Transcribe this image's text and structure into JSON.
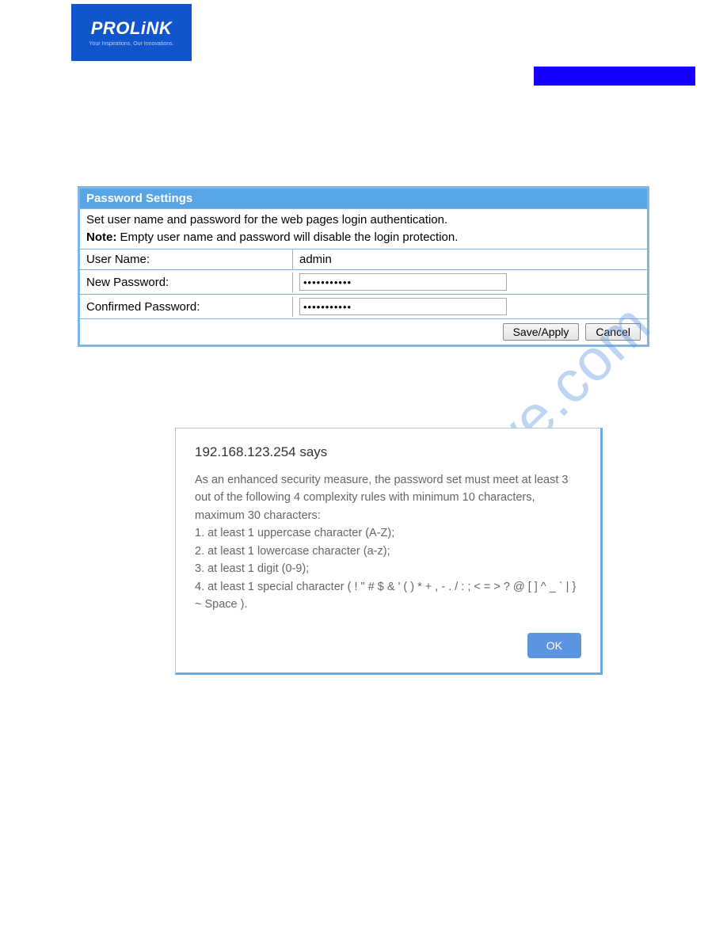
{
  "logo": {
    "brand": "PROLiNK",
    "tagline": "Your Inspirations, Our Innovations."
  },
  "panel": {
    "title": "Password Settings",
    "desc": "Set user name and password for the web pages login authentication.",
    "note_label": "Note:",
    "note_text": " Empty user name and password will disable the login protection.",
    "rows": {
      "username_label": "User Name:",
      "username_value": "admin",
      "newpass_label": "New Password:",
      "newpass_value": "•••••••••••",
      "confirm_label": "Confirmed Password:",
      "confirm_value": "•••••••••••"
    },
    "buttons": {
      "save": "Save/Apply",
      "cancel": "Cancel"
    }
  },
  "dialog": {
    "title": "192.168.123.254 says",
    "body_intro": "As an enhanced security measure, the password set must meet at least 3 out of the following 4 complexity rules with minimum 10 characters, maximum 30 characters:",
    "rule1": "1. at least 1 uppercase character (A-Z);",
    "rule2": "2. at least 1 lowercase character (a-z);",
    "rule3": "3. at least 1 digit (0-9);",
    "rule4": "4. at least 1 special character ( ! \" # $ & ' ( ) * + , - . / : ; < = > ? @ [ ] ^ _ ` | } ~ Space ).",
    "ok": "OK"
  },
  "watermark": "manualshive.com"
}
